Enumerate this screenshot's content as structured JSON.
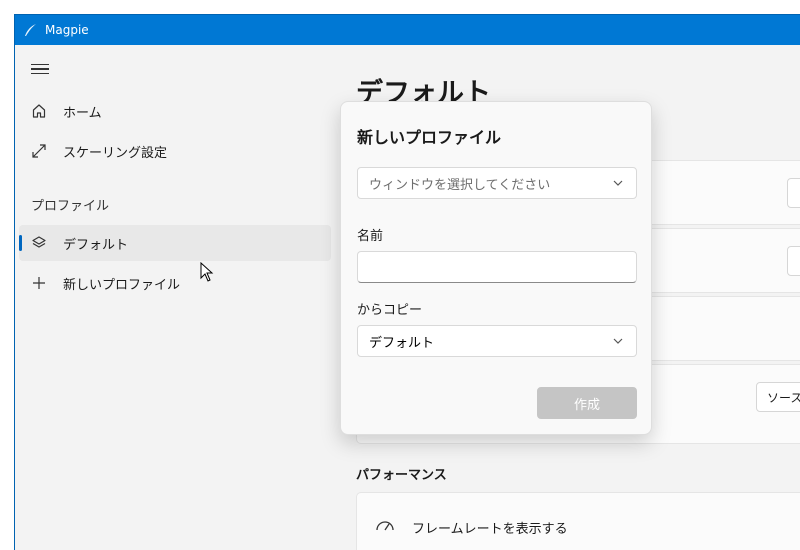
{
  "window": {
    "title": "Magpie",
    "accent": "#0078d4"
  },
  "sidebar": {
    "menu_icon": "hamburger-icon",
    "items": [
      {
        "label": "ホーム",
        "icon": "home-icon"
      },
      {
        "label": "スケーリング設定",
        "icon": "expand-arrows-icon"
      }
    ],
    "section_label": "プロファイル",
    "profiles": [
      {
        "label": "デフォルト",
        "icon": "layers-icon",
        "selected": true
      }
    ],
    "new_profile": {
      "label": "新しいプロファイル",
      "icon": "plus-icon"
    }
  },
  "main": {
    "title": "デフォルト",
    "source_button": "ソースウ",
    "section_performance": "パフォーマンス",
    "framerate_label": "フレームレートを表示する",
    "framerate_icon": "speedometer-icon"
  },
  "dialog": {
    "title": "新しいプロファイル",
    "window_select_placeholder": "ウィンドウを選択してください",
    "name_label": "名前",
    "name_value": "",
    "copy_from_label": "からコピー",
    "copy_from_value": "デフォルト",
    "create_button": "作成"
  }
}
